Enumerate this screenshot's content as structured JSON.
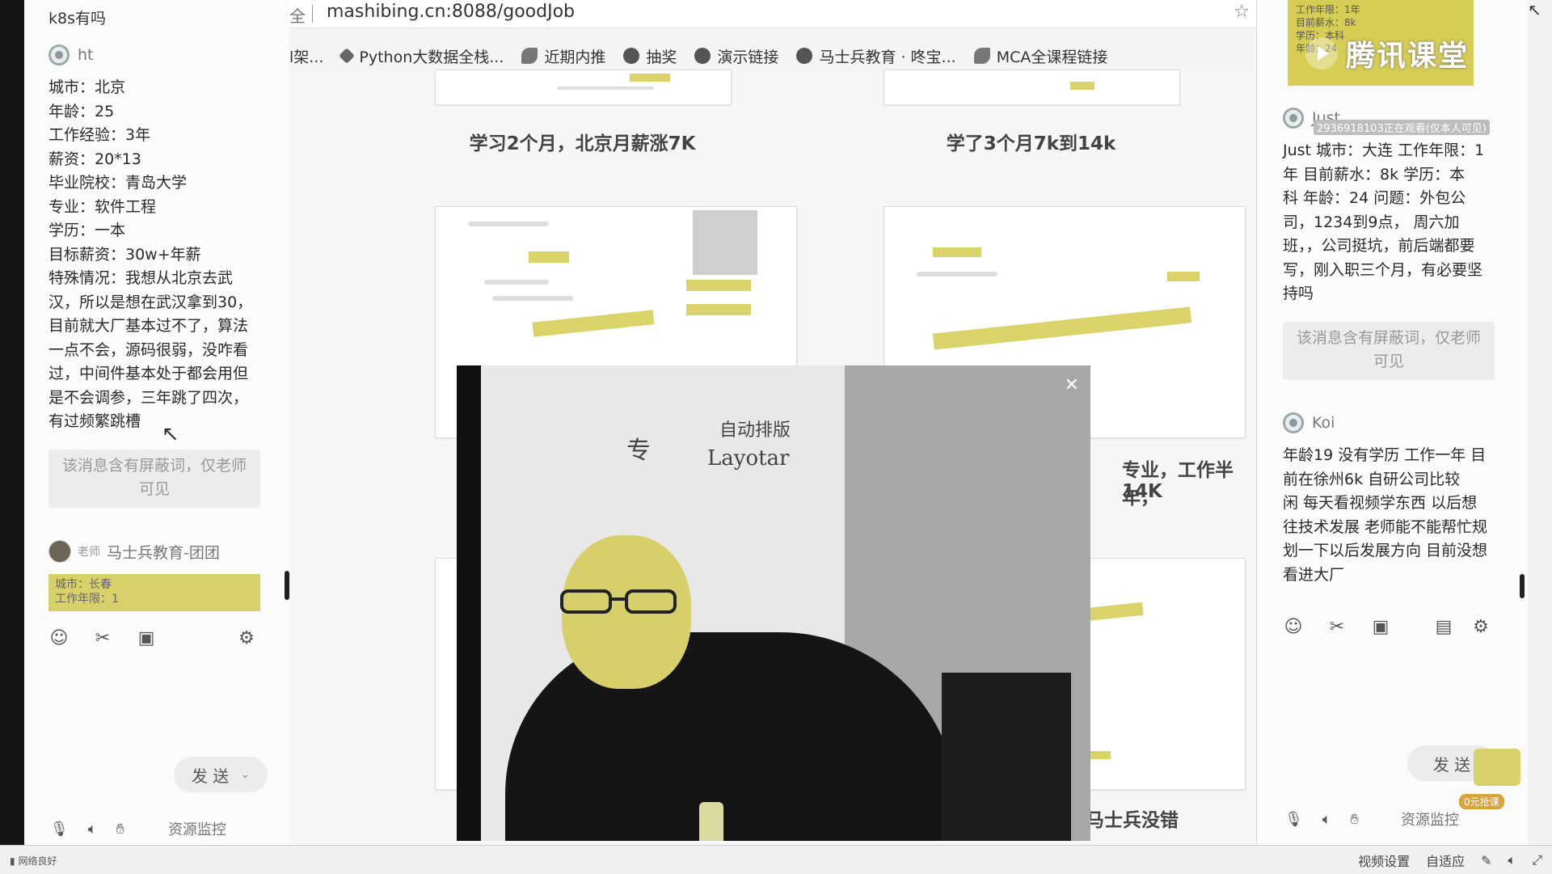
{
  "left_chat": {
    "top_text": "k8s有吗",
    "msg1": {
      "user": "ht",
      "lines": [
        "城市：北京",
        "年龄：25",
        "工作经验：3年",
        "薪资：20*13",
        "毕业院校：青岛大学",
        "专业：软件工程",
        "学历：一本",
        "目标薪资：30w+年薪",
        "特殊情况：我想从北京去武",
        "汉，所以是想在武汉拿到30，",
        "目前就大厂基本过不了，算法",
        "一点不会，源码很弱，没咋看",
        "过，中间件基本处于都会用但",
        "是不会调参，三年跳了四次，",
        "有过频繁跳槽"
      ]
    },
    "masked": [
      "该消息含有屏蔽词，仅老师",
      "可见"
    ],
    "teacher": {
      "tag": "老师",
      "name": "马士兵教育-团团",
      "preview": [
        "城市：长春",
        "工作年限：1"
      ]
    },
    "send_label": "发 送",
    "resource_label": "资源监控"
  },
  "browser": {
    "url_left": "全",
    "url": "mashibing.cn:8088/goodJob",
    "bookmarks": [
      "l架...",
      "Python大数据全栈...",
      "近期内推",
      "抽奖",
      "演示链接",
      "马士兵教育 · 咚宝...",
      "MCA全课程链接"
    ],
    "captions": [
      "学习2个月，北京月薪涨7K",
      "学了3个月7k到14k",
      "专业，工作半年，",
      "14K",
      "马士兵没错"
    ]
  },
  "right_chat": {
    "cam_lines": [
      "工作年限：1年",
      "目前薪水：8k",
      "学历：本科",
      "年龄：24"
    ],
    "tencent_label": "腾讯课堂",
    "msg1": {
      "user": "Just",
      "join_note": "2936918103正在观看(仅本人可见)",
      "lines": [
        "Just 城市：大连 工作年限：1",
        "年 目前薪水：8k 学历：本",
        "科 年龄：24 问题：外包公",
        "司，1234到9点， 周六加",
        "班，，公司挺坑，前后端都要",
        "写，刚入职三个月，有必要坚",
        "持吗"
      ]
    },
    "masked": [
      "该消息含有屏蔽词，仅老师",
      "可见"
    ],
    "msg2": {
      "user": "Koi",
      "lines": [
        "年龄19 没有学历 工作一年 目",
        "前在徐州6k 自研公司比较",
        "闲 每天看视频学东西 以后想",
        "往技术发展 老师能不能帮忙规",
        "划一下以后发展方向 目前没想",
        "看进大厂"
      ]
    },
    "send_label": "发 送",
    "promo_badge": "0元抢课",
    "resource_label": "资源监控"
  },
  "status_bar": {
    "network": "网络良好",
    "items": [
      "视频设置",
      "自适应"
    ]
  },
  "video": {
    "board_texts": [
      "专",
      "自动排版",
      "Layotar"
    ]
  }
}
